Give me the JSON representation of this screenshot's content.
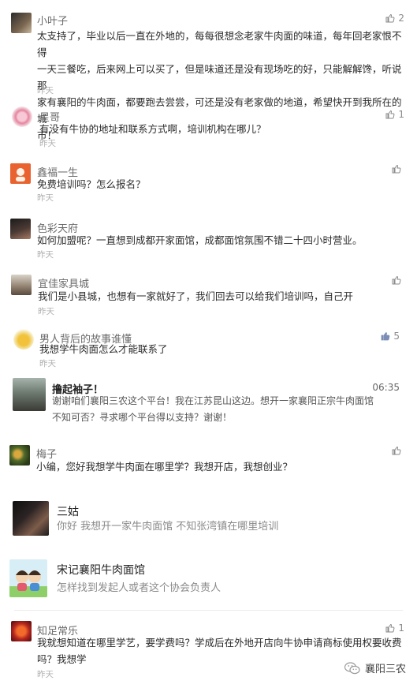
{
  "comments": [
    {
      "name": "小叶子",
      "lines": [
        "太支持了，毕业以后一直在外地的，每每很想念老家牛肉面的味道，每年回老家恨不得",
        "一天三餐吃，后来网上可以买了，但是味道还是没有现场吃的好，只能解解馋，听说那",
        "家有襄阳的牛肉面，都要跑去尝尝，可还是没有老家做的地道，希望快开到我所在的城",
        "市！"
      ],
      "time": "昨天",
      "likes": "2"
    },
    {
      "name": "星哥",
      "lines": [
        "有没有牛协的地址和联系方式啊，培训机构在哪儿？"
      ],
      "time": "昨天",
      "likes": "1"
    },
    {
      "name": "鑫福一生",
      "lines": [
        "免费培训吗？怎么报名？"
      ],
      "time": "昨天",
      "likes": ""
    },
    {
      "name": "色彩天府",
      "lines": [
        "如何加盟呢？一直想到成都开家面馆，成都面馆氛围不错二十四小时营业。"
      ],
      "time": "昨天",
      "likes": ""
    },
    {
      "name": "宜佳家具城",
      "lines": [
        "我们是小县城，也想有一家就好了，我们回去可以给我们培训吗，自己开"
      ],
      "time": "昨天",
      "likes": ""
    },
    {
      "name": "男人背后的故事谁懂",
      "lines": [
        "我想学牛肉面怎么才能联系了"
      ],
      "time": "昨天",
      "likes": "5"
    },
    {
      "name": "撸起袖子！",
      "lines": [
        "谢谢咱们襄阳三农这个平台！我在江苏昆山这边。想开一家襄阳正宗牛肉面馆",
        "不知可否？寻求哪个平台得以支持？谢谢！"
      ],
      "time": "06:35"
    },
    {
      "name": "梅子",
      "lines": [
        "小编，您好我想学牛肉面在哪里学？我想开店，我想创业？"
      ],
      "time": "昨天",
      "likes": ""
    },
    {
      "name": "三姑",
      "lines": [
        "你好 我想开一家牛肉面馆 不知张湾镇在哪里培训"
      ]
    },
    {
      "name": "宋记襄阳牛肉面馆",
      "lines": [
        "怎样找到发起人或者这个协会负责人"
      ]
    },
    {
      "name": "知足常乐",
      "lines": [
        "我就想知道在哪里学艺，要学费吗？学成后在外地开店向牛协申请商标使用权要收费",
        "吗？我想学"
      ],
      "time": "昨天",
      "likes": "1"
    }
  ],
  "watermark": {
    "label": "襄阳三农"
  }
}
